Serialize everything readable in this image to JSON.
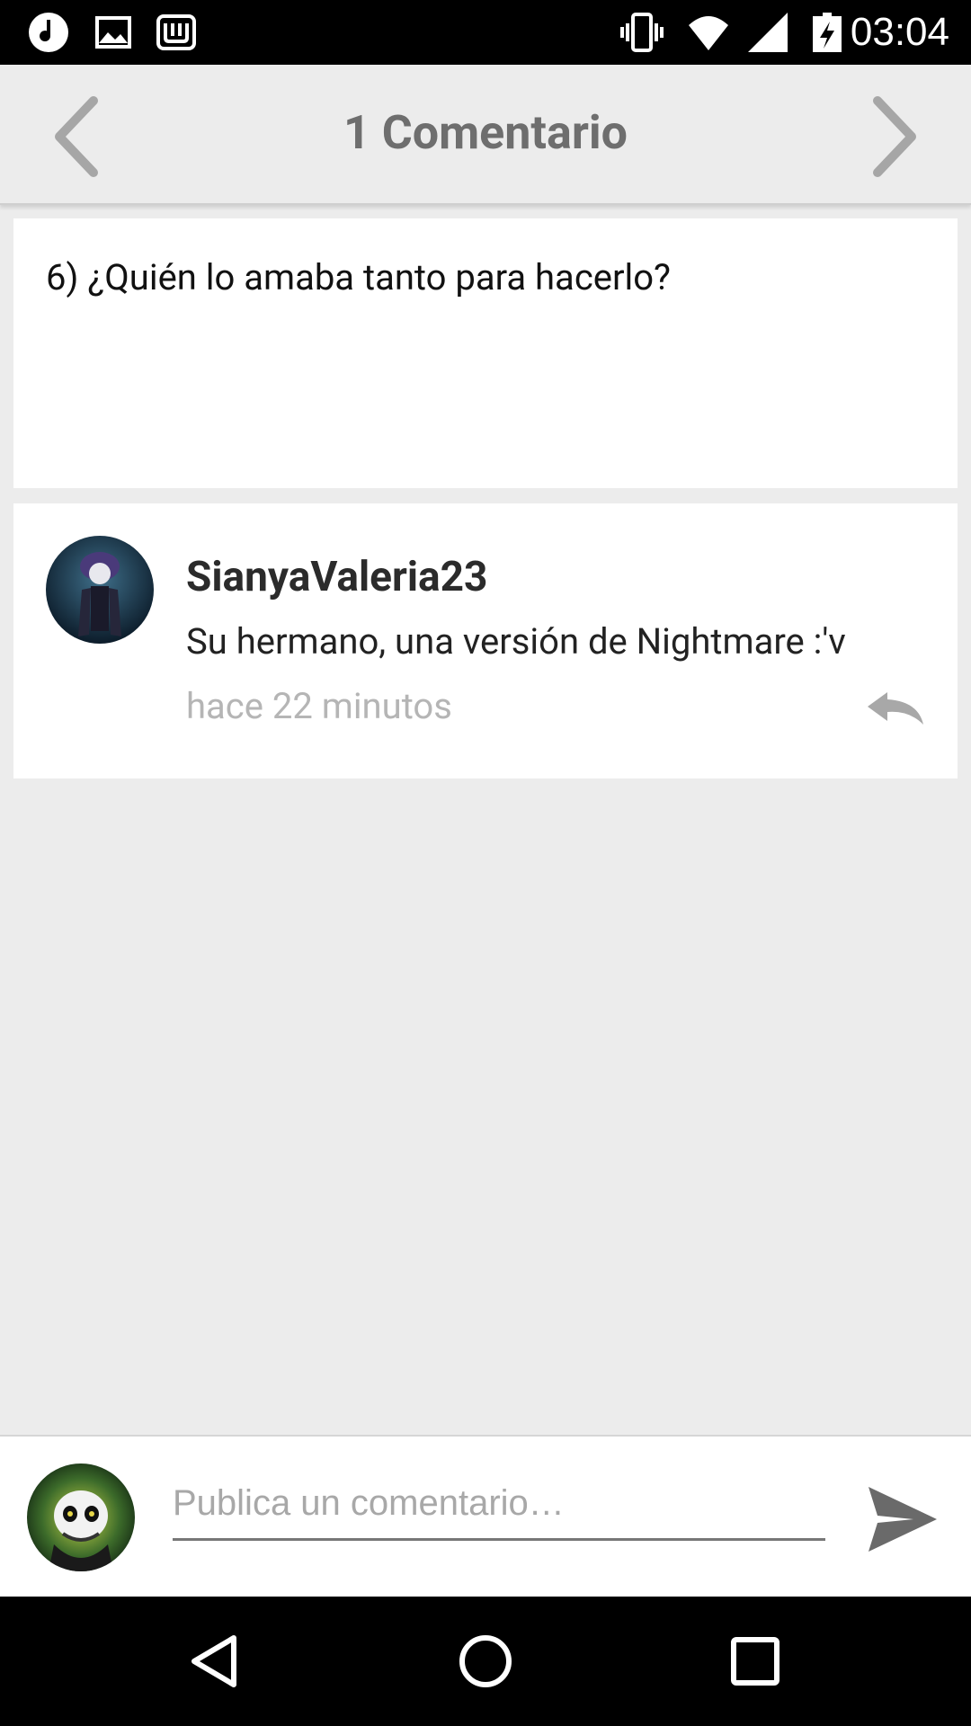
{
  "status_bar": {
    "time": "03:04",
    "left_icons": [
      "music-note-icon",
      "image-icon",
      "wattpad-icon"
    ],
    "right_icons": [
      "vibrate-icon",
      "wifi-icon",
      "signal-icon",
      "battery-charging-icon"
    ]
  },
  "header": {
    "title": "1 Comentario"
  },
  "post": {
    "text": "6) ¿Quién lo amaba tanto para hacerlo?"
  },
  "comments": [
    {
      "author": "SianyaValeria23",
      "text": "Su hermano, una versión de Nightmare :'v",
      "time": "hace 22 minutos"
    }
  ],
  "composer": {
    "placeholder": "Publica un comentario…",
    "value": ""
  },
  "colors": {
    "background": "#ececec",
    "card": "#ffffff",
    "header_text": "#6e6e6e",
    "timestamp": "#b5b5b5"
  }
}
